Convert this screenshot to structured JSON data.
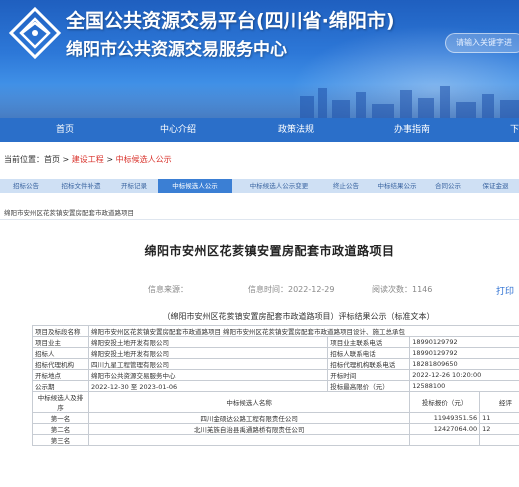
{
  "header": {
    "title_main": "全国公共资源交易平台(四川省·绵阳市)",
    "title_sub": "绵阳市公共资源交易服务中心",
    "search_placeholder": "请输入关键字进"
  },
  "nav": {
    "items": [
      "首页",
      "中心介绍",
      "政策法规",
      "办事指南",
      "下"
    ]
  },
  "breadcrumb": {
    "prefix": "当前位置：",
    "home": "首页",
    "sep1": " > ",
    "section": "建设工程",
    "sep2": " > ",
    "current": "中标候选人公示"
  },
  "tabs": [
    "招标公告",
    "招标文件补遗",
    "开标记录",
    "中标候选人公示",
    "中标候选人公示变更",
    "终止公告",
    "中标结果公示",
    "合同公示",
    "保证金退"
  ],
  "subhead": "绵阳市安州区花荄镇安置房配套市政道路项目",
  "article": {
    "title": "绵阳市安州区花荄镇安置房配套市政道路项目",
    "source_label": "信息来源：",
    "time_label": "信息时间：2022-12-29",
    "views_label": "阅读次数：1146",
    "print": "打印"
  },
  "notice": "（绵阳市安州区花荄镇安置房配套市政道路项目）评标结果公示（标准文本）",
  "table": {
    "rows": [
      {
        "k": "项目及标段名称",
        "v": "绵阳市安州区花荄镇安置房配套市政道路项目 绵阳市安州区花荄镇安置房配套市政道路项目设计、施工总承包"
      },
      {
        "k": "项目业主",
        "v": "绵阳安投土地开发有限公司",
        "k2": "项目业主联系电话",
        "v2": "18990129792"
      },
      {
        "k": "招标人",
        "v": "绵阳安投土地开发有限公司",
        "k2": "招标人联系电话",
        "v2": "18990129792"
      },
      {
        "k": "招标代理机构",
        "v": "四川九星工程管理有限公司",
        "k2": "招标代理机构联系电话",
        "v2": "18281809650"
      },
      {
        "k": "开标地点",
        "v": "绵阳市公共资源交易服务中心",
        "k2": "开标时间",
        "v2": "2022-12-26 10:20:00"
      },
      {
        "k": "公示期",
        "v": "2022-12-30 至 2023-01-06",
        "k2": "投标最高限价（元）",
        "v2": "12588100"
      }
    ],
    "candidates_header": {
      "rank": "中标候选人及排序",
      "name": "中标候选人名称",
      "price": "投标报价（元）",
      "extra": "经评"
    },
    "candidates": [
      {
        "rank": "第一名",
        "name": "四川金硕达公路工程有限责任公司",
        "price": "11949351.56",
        "extra": "11"
      },
      {
        "rank": "第二名",
        "name": "北川羌族自治县禹通路桥有限责任公司",
        "price": "12427064.00",
        "extra": "12"
      },
      {
        "rank": "第三名",
        "name": "",
        "price": "",
        "extra": ""
      }
    ]
  },
  "colors": {
    "banner_top": "#1f5fbf",
    "nav": "#2b6fc9",
    "tab_bar": "#cfe0f4",
    "tab_active": "#3b7fd4",
    "breadcrumb_current": "#d9322b",
    "link": "#2c6fd1"
  }
}
